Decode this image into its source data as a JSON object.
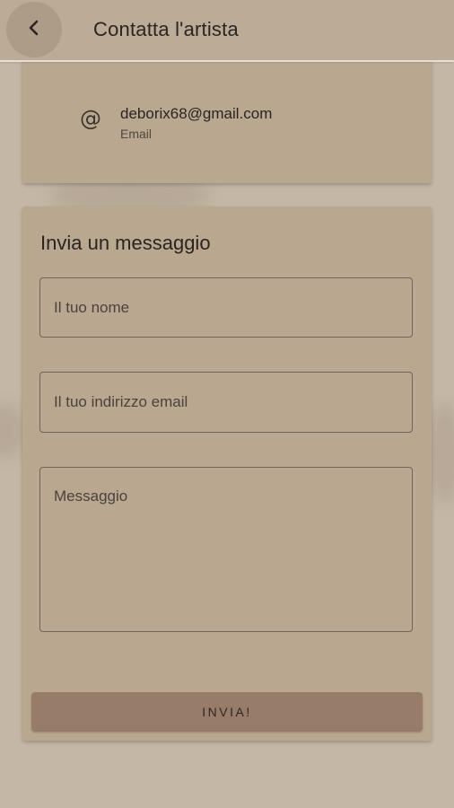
{
  "header": {
    "title": "Contatta l'artista",
    "back_icon": "chevron-left-icon"
  },
  "contact": {
    "icon": "at-icon",
    "icon_glyph": "@",
    "value": "deborix68@gmail.com",
    "type": "Email"
  },
  "form": {
    "title": "Invia un messaggio",
    "name_placeholder": "Il tuo nome",
    "email_placeholder": "Il tuo indirizzo email",
    "message_placeholder": "Messaggio",
    "name_value": "",
    "email_value": "",
    "message_value": "",
    "submit_label": "INVIA!"
  },
  "colors": {
    "background": "#c5b7a6",
    "topbar": "#bcab96",
    "card": "#b9a790",
    "button": "#977d69"
  }
}
